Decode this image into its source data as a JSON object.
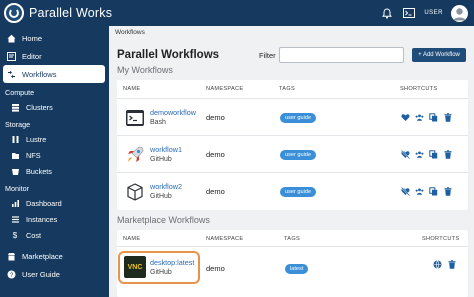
{
  "app": {
    "brand_name": "Parallel Works",
    "user_label": "USER"
  },
  "sidebar": {
    "items_top": [
      {
        "label": "Home",
        "icon": "home-icon"
      },
      {
        "label": "Editor",
        "icon": "editor-icon"
      },
      {
        "label": "Workflows",
        "icon": "workflows-icon",
        "active": true
      }
    ],
    "compute_label": "Compute",
    "compute_items": [
      {
        "label": "Clusters",
        "icon": "clusters-icon"
      }
    ],
    "storage_label": "Storage",
    "storage_items": [
      {
        "label": "Lustre",
        "icon": "lustre-icon"
      },
      {
        "label": "NFS",
        "icon": "nfs-icon"
      },
      {
        "label": "Buckets",
        "icon": "buckets-icon"
      }
    ],
    "monitor_label": "Monitor",
    "monitor_items": [
      {
        "label": "Dashboard",
        "icon": "dashboard-icon"
      },
      {
        "label": "Instances",
        "icon": "instances-icon"
      },
      {
        "label": "Cost",
        "icon": "dollar-icon"
      }
    ],
    "items_bottom": [
      {
        "label": "Marketplace",
        "icon": "marketplace-icon"
      },
      {
        "label": "User Guide",
        "icon": "user-guide-icon"
      }
    ]
  },
  "main": {
    "breadcrumb": "Workflows",
    "title": "Parallel Workflows",
    "filter_label": "Filter",
    "filter_value": "",
    "add_button": "+ Add Workflow",
    "my_workflows_title": "My Workflows",
    "columns": {
      "name": "NAME",
      "namespace": "NAMESPACE",
      "tags": "TAGS",
      "shortcuts": "SHORTCUTS"
    },
    "my_workflows": [
      {
        "name": "demoworkflow",
        "source": "Bash",
        "namespace": "demo",
        "tag": "user guide",
        "thumb": "terminal-icon"
      },
      {
        "name": "workflow1",
        "source": "GitHub",
        "namespace": "demo",
        "tag": "user guide",
        "thumb": "rocket-icon"
      },
      {
        "name": "workflow2",
        "source": "GitHub",
        "namespace": "demo",
        "tag": "user guide",
        "thumb": "cube-icon"
      }
    ],
    "marketplace_title": "Marketplace Workflows",
    "marketplace_workflows": [
      {
        "name": "desktop:latest",
        "source": "GitHub",
        "namespace": "demo",
        "tag": "latest",
        "thumb": "vnc-icon",
        "thumb_text": "VNC"
      }
    ]
  },
  "colors": {
    "sidebar_bg": "#163a5f",
    "accent": "#1f4c78",
    "tag_bg": "#3b8fd8",
    "link": "#2a6bb5",
    "highlight": "#e8934a"
  }
}
